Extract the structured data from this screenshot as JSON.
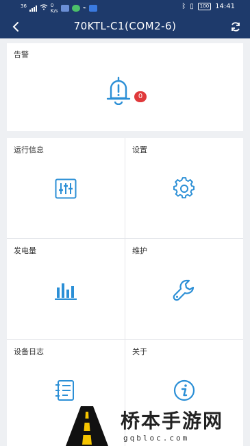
{
  "status_bar": {
    "network": "36",
    "speed_value": "0",
    "speed_unit": "K/s",
    "battery": "100",
    "time": "14:41"
  },
  "header": {
    "title": "70KTL-C1(COM2-6)",
    "back_icon": "back-arrow-icon",
    "refresh_icon": "refresh-icon",
    "bg_color": "#1e3a6b"
  },
  "alarm": {
    "label": "告警",
    "count": "0",
    "icon": "bell-alert-icon",
    "badge_color": "#e0393b"
  },
  "menu": [
    {
      "label": "运行信息",
      "icon": "sliders-icon"
    },
    {
      "label": "设置",
      "icon": "gear-icon"
    },
    {
      "label": "发电量",
      "icon": "bar-chart-icon"
    },
    {
      "label": "维护",
      "icon": "wrench-icon"
    },
    {
      "label": "设备日志",
      "icon": "log-list-icon"
    },
    {
      "label": "关于",
      "icon": "info-icon"
    }
  ],
  "accent_color": "#2b8fd6",
  "watermark": {
    "title": "桥本手游网",
    "url": "gqbloc.com"
  }
}
